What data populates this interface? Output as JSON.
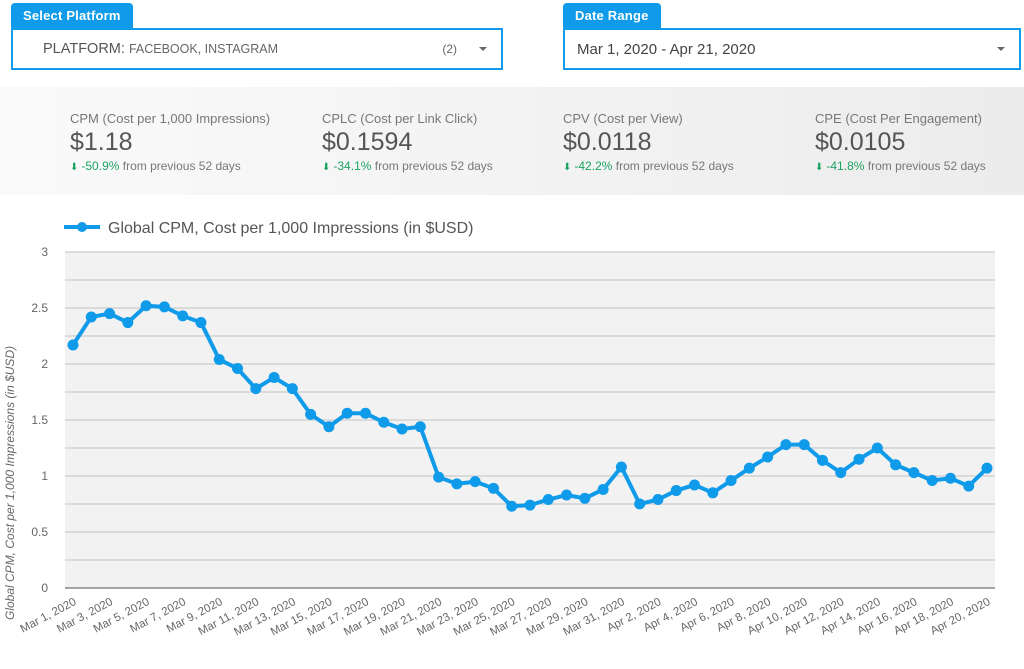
{
  "filters": {
    "platform": {
      "tab_label": "Select Platform",
      "key": "PLATFORM",
      "values": "FACEBOOK, INSTAGRAM",
      "count": "(2)",
      "icon": "caret-down-icon"
    },
    "date_range": {
      "tab_label": "Date Range",
      "value": "Mar 1, 2020 - Apr 21, 2020",
      "icon": "caret-down-icon"
    }
  },
  "kpis": [
    {
      "label": "CPM (Cost per 1,000 Impressions)",
      "value": "$1.18",
      "change": "-50.9%",
      "change_suffix": " from previous 52 days",
      "direction": "down"
    },
    {
      "label": "CPLC (Cost per Link Click)",
      "value": "$0.1594",
      "change": "-34.1%",
      "change_suffix": " from previous 52 days",
      "direction": "down"
    },
    {
      "label": "CPV (Cost per View)",
      "value": "$0.0118",
      "change": "-42.2%",
      "change_suffix": " from previous 52 days",
      "direction": "down"
    },
    {
      "label": "CPE (Cost Per Engagement)",
      "value": "$0.0105",
      "change": "-41.8%",
      "change_suffix": " from previous 52 days",
      "direction": "down"
    }
  ],
  "colors": {
    "accent": "#0f9bea",
    "series": "#0f9bea",
    "positive_change": "#1ea362",
    "plot_bg": "#f2f2f2",
    "grid": "#cccccc"
  },
  "chart_data": {
    "type": "line",
    "title": "",
    "legend": [
      "Global CPM, Cost per 1,000 Impressions (in $USD)"
    ],
    "legend_position": "top-left",
    "xlabel": "",
    "ylabel": "Global CPM, Cost per 1,000 Impressions (in $USD)",
    "ylim": [
      0,
      3
    ],
    "yticks": [
      "0",
      "0.5",
      "1",
      "1.5",
      "2",
      "2.5",
      "3"
    ],
    "ytick_values": [
      0,
      0.5,
      1,
      1.5,
      2,
      2.5,
      3
    ],
    "grid": true,
    "x": [
      "Mar 1, 2020",
      "Mar 2, 2020",
      "Mar 3, 2020",
      "Mar 4, 2020",
      "Mar 5, 2020",
      "Mar 6, 2020",
      "Mar 7, 2020",
      "Mar 8, 2020",
      "Mar 9, 2020",
      "Mar 10, 2020",
      "Mar 11, 2020",
      "Mar 12, 2020",
      "Mar 13, 2020",
      "Mar 14, 2020",
      "Mar 15, 2020",
      "Mar 16, 2020",
      "Mar 17, 2020",
      "Mar 18, 2020",
      "Mar 19, 2020",
      "Mar 20, 2020",
      "Mar 21, 2020",
      "Mar 22, 2020",
      "Mar 23, 2020",
      "Mar 24, 2020",
      "Mar 25, 2020",
      "Mar 26, 2020",
      "Mar 27, 2020",
      "Mar 28, 2020",
      "Mar 29, 2020",
      "Mar 30, 2020",
      "Mar 31, 2020",
      "Apr 1, 2020",
      "Apr 2, 2020",
      "Apr 3, 2020",
      "Apr 4, 2020",
      "Apr 5, 2020",
      "Apr 6, 2020",
      "Apr 7, 2020",
      "Apr 8, 2020",
      "Apr 9, 2020",
      "Apr 10, 2020",
      "Apr 11, 2020",
      "Apr 12, 2020",
      "Apr 13, 2020",
      "Apr 14, 2020",
      "Apr 15, 2020",
      "Apr 16, 2020",
      "Apr 17, 2020",
      "Apr 18, 2020",
      "Apr 19, 2020",
      "Apr 20, 2020"
    ],
    "xtick_labels": [
      "Mar 1, 2020",
      "Mar 3, 2020",
      "Mar 5, 2020",
      "Mar 7, 2020",
      "Mar 9, 2020",
      "Mar 11, 2020",
      "Mar 13, 2020",
      "Mar 15, 2020",
      "Mar 17, 2020",
      "Mar 19, 2020",
      "Mar 21, 2020",
      "Mar 23, 2020",
      "Mar 25, 2020",
      "Mar 27, 2020",
      "Mar 29, 2020",
      "Mar 31, 2020",
      "Apr 2, 2020",
      "Apr 4, 2020",
      "Apr 6, 2020",
      "Apr 8, 2020",
      "Apr 10, 2020",
      "Apr 12, 2020",
      "Apr 14, 2020",
      "Apr 16, 2020",
      "Apr 18, 2020",
      "Apr 20, 2020"
    ],
    "series": [
      {
        "name": "Global CPM, Cost per 1,000 Impressions (in $USD)",
        "values": [
          2.17,
          2.42,
          2.45,
          2.37,
          2.52,
          2.51,
          2.43,
          2.37,
          2.04,
          1.96,
          1.78,
          1.88,
          1.78,
          1.55,
          1.44,
          1.56,
          1.56,
          1.48,
          1.42,
          1.44,
          0.99,
          0.93,
          0.95,
          0.89,
          0.73,
          0.74,
          0.79,
          0.83,
          0.8,
          0.88,
          1.08,
          0.75,
          0.79,
          0.87,
          0.92,
          0.85,
          0.96,
          1.07,
          1.17,
          1.28,
          1.28,
          1.14,
          1.03,
          1.15,
          1.25,
          1.1,
          1.03,
          0.96,
          0.98,
          0.91,
          1.07
        ]
      }
    ]
  }
}
